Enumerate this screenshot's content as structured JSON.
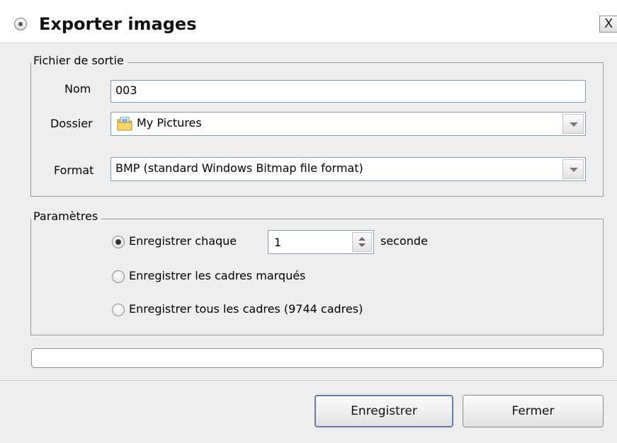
{
  "window": {
    "title": "Exporter images",
    "close_label": "X"
  },
  "output_group": {
    "legend": "Fichier de sortie",
    "name_label": "Nom",
    "name_value": "003",
    "folder_label": "Dossier",
    "folder_value": "My Pictures",
    "folder_icon": "folder-pictures-icon",
    "format_label": "Format",
    "format_value": "BMP (standard Windows Bitmap file format)"
  },
  "params_group": {
    "legend": "Paramètres",
    "option_every": "Enregistrer chaque",
    "every_value": "1",
    "every_unit": "seconde",
    "option_marked": "Enregistrer les cadres marqués",
    "option_all": "Enregistrer tous les cadres (9744 cadres)",
    "selected_option": "every"
  },
  "progress": {
    "value": 0
  },
  "buttons": {
    "save": "Enregistrer",
    "close": "Fermer"
  }
}
